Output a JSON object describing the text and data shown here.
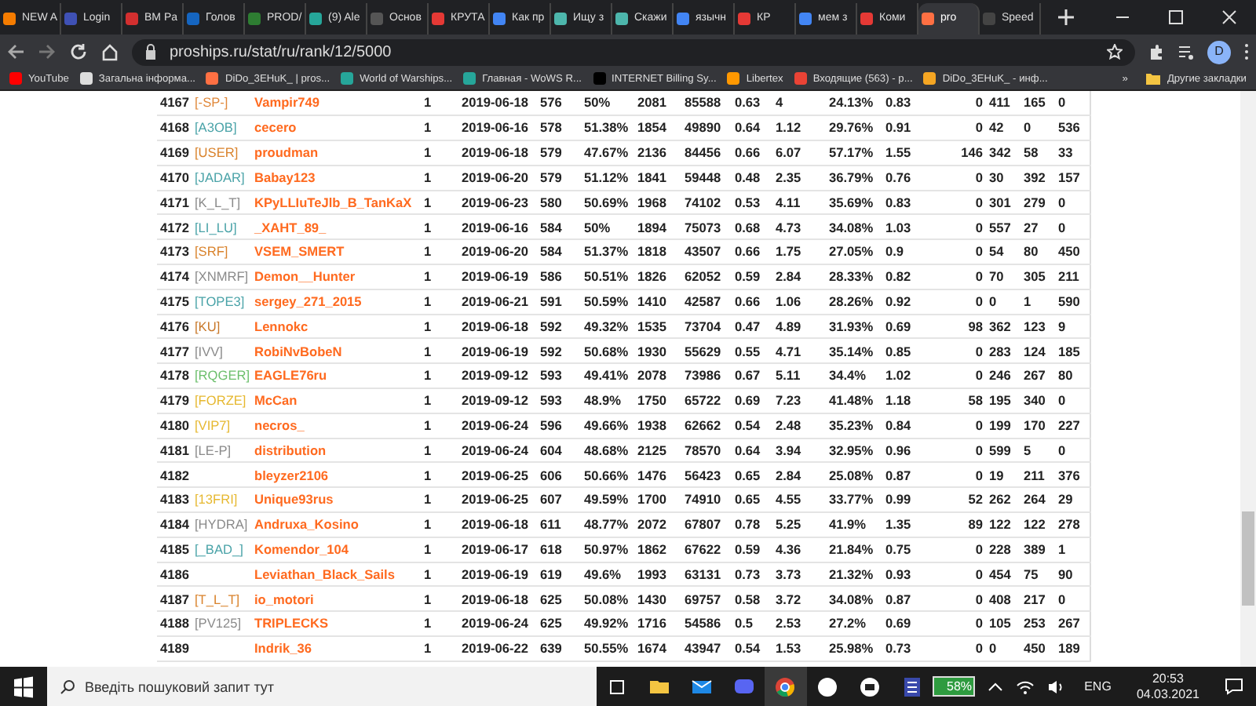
{
  "tabs": [
    {
      "label": "NEW A",
      "selected": false,
      "color": "#f57c00"
    },
    {
      "label": "Login",
      "selected": false,
      "color": "#3f51b5"
    },
    {
      "label": "BM Pa",
      "selected": false,
      "color": "#d32f2f"
    },
    {
      "label": "Голов",
      "selected": false,
      "color": "#1565c0"
    },
    {
      "label": "PROD/",
      "selected": false,
      "color": "#2e7d32"
    },
    {
      "label": "(9) Ale",
      "selected": false,
      "color": "#26a69a"
    },
    {
      "label": "Основ",
      "selected": false,
      "color": "#555555"
    },
    {
      "label": "КРУТА",
      "selected": false,
      "color": "#e53935"
    },
    {
      "label": "Как пр",
      "selected": false,
      "color": "#4285f4"
    },
    {
      "label": "Ищу з",
      "selected": false,
      "color": "#4db6ac"
    },
    {
      "label": "Скажи",
      "selected": false,
      "color": "#4db6ac"
    },
    {
      "label": "язычн",
      "selected": false,
      "color": "#4285f4"
    },
    {
      "label": "КР",
      "selected": false,
      "color": "#e53935"
    },
    {
      "label": "мем з",
      "selected": false,
      "color": "#4285f4"
    },
    {
      "label": "Коми",
      "selected": false,
      "color": "#e53935"
    },
    {
      "label": "pro",
      "selected": true,
      "color": "#ff7043"
    },
    {
      "label": "Speed",
      "selected": false,
      "color": "#444444"
    }
  ],
  "address": "proships.ru/stat/ru/rank/12/5000",
  "profile": "D",
  "bookmarks": [
    {
      "label": "YouTube",
      "color": "#ff0000"
    },
    {
      "label": "Загальна інформа...",
      "color": "#dddddd"
    },
    {
      "label": "DiDo_3EHuK_ | pros...",
      "color": "#ff7043"
    },
    {
      "label": "World of Warships...",
      "color": "#26a69a"
    },
    {
      "label": "Главная - WoWS R...",
      "color": "#26a69a"
    },
    {
      "label": "INTERNET Billing Sy...",
      "color": "#000000"
    },
    {
      "label": "Libertex",
      "color": "#ff9800"
    },
    {
      "label": "Входящие (563) - p...",
      "color": "#ea4335"
    },
    {
      "label": "DiDo_3EHuK_ - инф...",
      "color": "#f5a623"
    }
  ],
  "bookmarks_more": "»",
  "other_bookmarks": "Другие закладки",
  "table": {
    "rows": [
      {
        "number": "4167",
        "clan": {
          "text": "[-SP-]",
          "color": "#e0883a"
        },
        "player": "Vampir749",
        "values": [
          "1",
          "2019-06-18",
          "576",
          "50%",
          "2081",
          "85588",
          "0.63",
          "4",
          "24.13%",
          "0.83",
          "0",
          "411",
          "165",
          "0"
        ]
      },
      {
        "number": "4168",
        "clan": {
          "text": "[A3OB]",
          "color": "#4aa3a8"
        },
        "player": "cecero",
        "values": [
          "1",
          "2019-06-16",
          "578",
          "51.38%",
          "1854",
          "49890",
          "0.64",
          "1.12",
          "29.76%",
          "0.91",
          "0",
          "42",
          "0",
          "536"
        ]
      },
      {
        "number": "4169",
        "clan": {
          "text": "[USER]",
          "color": "#d9822b"
        },
        "player": "proudman",
        "values": [
          "1",
          "2019-06-18",
          "579",
          "47.67%",
          "2136",
          "84456",
          "0.66",
          "6.07",
          "57.17%",
          "1.55",
          "146",
          "342",
          "58",
          "33"
        ]
      },
      {
        "number": "4170",
        "clan": {
          "text": "[JADAR]",
          "color": "#4aa3a8"
        },
        "player": "Babay123",
        "values": [
          "1",
          "2019-06-20",
          "579",
          "51.12%",
          "1841",
          "59448",
          "0.48",
          "2.35",
          "36.79%",
          "0.76",
          "0",
          "30",
          "392",
          "157"
        ]
      },
      {
        "number": "4171",
        "clan": {
          "text": "[K_L_T]",
          "color": "#8a8a8a"
        },
        "player": "KPyLLIuTeJlb_B_TanKaX",
        "values": [
          "1",
          "2019-06-23",
          "580",
          "50.69%",
          "1968",
          "74102",
          "0.53",
          "4.11",
          "35.69%",
          "0.83",
          "0",
          "301",
          "279",
          "0"
        ]
      },
      {
        "number": "4172",
        "clan": {
          "text": "[LI_LU]",
          "color": "#4aa3a8"
        },
        "player": "_XAHT_89_",
        "values": [
          "1",
          "2019-06-16",
          "584",
          "50%",
          "1894",
          "75073",
          "0.68",
          "4.73",
          "34.08%",
          "1.03",
          "0",
          "557",
          "27",
          "0"
        ]
      },
      {
        "number": "4173",
        "clan": {
          "text": "[SRF]",
          "color": "#d9822b"
        },
        "player": "VSEM_SMERT",
        "values": [
          "1",
          "2019-06-20",
          "584",
          "51.37%",
          "1818",
          "43507",
          "0.66",
          "1.75",
          "27.05%",
          "0.9",
          "0",
          "54",
          "80",
          "450"
        ]
      },
      {
        "number": "4174",
        "clan": {
          "text": "[XNMRF]",
          "color": "#8a8a8a"
        },
        "player": "Demon__Hunter",
        "values": [
          "1",
          "2019-06-19",
          "586",
          "50.51%",
          "1826",
          "62052",
          "0.59",
          "2.84",
          "28.33%",
          "0.82",
          "0",
          "70",
          "305",
          "211"
        ]
      },
      {
        "number": "4175",
        "clan": {
          "text": "[TOPE3]",
          "color": "#4aa3a8"
        },
        "player": "sergey_271_2015",
        "values": [
          "1",
          "2019-06-21",
          "591",
          "50.59%",
          "1410",
          "42587",
          "0.66",
          "1.06",
          "28.26%",
          "0.92",
          "0",
          "0",
          "1",
          "590"
        ]
      },
      {
        "number": "4176",
        "clan": {
          "text": "[KU]",
          "color": "#c8782a"
        },
        "player": "Lennokc",
        "values": [
          "1",
          "2019-06-18",
          "592",
          "49.32%",
          "1535",
          "73704",
          "0.47",
          "4.89",
          "31.93%",
          "0.69",
          "98",
          "362",
          "123",
          "9"
        ]
      },
      {
        "number": "4177",
        "clan": {
          "text": "[IVV]",
          "color": "#8a8a8a"
        },
        "player": "RobiNvBobeN",
        "values": [
          "1",
          "2019-06-19",
          "592",
          "50.68%",
          "1930",
          "55629",
          "0.55",
          "4.71",
          "35.14%",
          "0.85",
          "0",
          "283",
          "124",
          "185"
        ]
      },
      {
        "number": "4178",
        "clan": {
          "text": "[RQGER]",
          "color": "#6cbf6c"
        },
        "player": "EAGLE76ru",
        "values": [
          "1",
          "2019-09-12",
          "593",
          "49.41%",
          "2078",
          "73986",
          "0.67",
          "5.11",
          "34.4%",
          "1.02",
          "0",
          "246",
          "267",
          "80"
        ]
      },
      {
        "number": "4179",
        "clan": {
          "text": "[FORZE]",
          "color": "#e6b830"
        },
        "player": "McCan",
        "values": [
          "1",
          "2019-09-12",
          "593",
          "48.9%",
          "1750",
          "65722",
          "0.69",
          "7.23",
          "41.48%",
          "1.18",
          "58",
          "195",
          "340",
          "0"
        ]
      },
      {
        "number": "4180",
        "clan": {
          "text": "[VIP7]",
          "color": "#e6b830"
        },
        "player": "necros_",
        "values": [
          "1",
          "2019-06-24",
          "596",
          "49.66%",
          "1938",
          "62662",
          "0.54",
          "2.48",
          "35.23%",
          "0.84",
          "0",
          "199",
          "170",
          "227"
        ]
      },
      {
        "number": "4181",
        "clan": {
          "text": "[LE-P]",
          "color": "#8a8a8a"
        },
        "player": "distribution",
        "values": [
          "1",
          "2019-06-24",
          "604",
          "48.68%",
          "2125",
          "78570",
          "0.64",
          "3.94",
          "32.95%",
          "0.96",
          "0",
          "599",
          "5",
          "0"
        ]
      },
      {
        "number": "4182",
        "player": "bleyzer2106",
        "values": [
          "1",
          "2019-06-25",
          "606",
          "50.66%",
          "1476",
          "56423",
          "0.65",
          "2.84",
          "25.08%",
          "0.87",
          "0",
          "19",
          "211",
          "376"
        ]
      },
      {
        "number": "4183",
        "clan": {
          "text": "[13FRI]",
          "color": "#e6b830"
        },
        "player": "Unique93rus",
        "values": [
          "1",
          "2019-06-25",
          "607",
          "49.59%",
          "1700",
          "74910",
          "0.65",
          "4.55",
          "33.77%",
          "0.99",
          "52",
          "262",
          "264",
          "29"
        ]
      },
      {
        "number": "4184",
        "clan": {
          "text": "[HYDRA]",
          "color": "#8a8a8a"
        },
        "player": "Andruxa_Kosino",
        "values": [
          "1",
          "2019-06-18",
          "611",
          "48.77%",
          "2072",
          "67807",
          "0.78",
          "5.25",
          "41.9%",
          "1.35",
          "89",
          "122",
          "122",
          "278"
        ]
      },
      {
        "number": "4185",
        "clan": {
          "text": "[_BAD_]",
          "color": "#4aa3a8"
        },
        "player": "Komendor_104",
        "values": [
          "1",
          "2019-06-17",
          "618",
          "50.97%",
          "1862",
          "67622",
          "0.59",
          "4.36",
          "21.84%",
          "0.75",
          "0",
          "228",
          "389",
          "1"
        ]
      },
      {
        "number": "4186",
        "player": "Leviathan_Black_Sails",
        "values": [
          "1",
          "2019-06-19",
          "619",
          "49.6%",
          "1993",
          "63131",
          "0.73",
          "3.73",
          "21.32%",
          "0.93",
          "0",
          "454",
          "75",
          "90"
        ]
      },
      {
        "number": "4187",
        "clan": {
          "text": "[T_L_T]",
          "color": "#d9822b"
        },
        "player": "io_motori",
        "values": [
          "1",
          "2019-06-18",
          "625",
          "50.08%",
          "1430",
          "69757",
          "0.58",
          "3.72",
          "34.08%",
          "0.87",
          "0",
          "408",
          "217",
          "0"
        ]
      },
      {
        "number": "4188",
        "clan": {
          "text": "[PV125]",
          "color": "#8a8a8a"
        },
        "player": "TRIPLECKS",
        "values": [
          "1",
          "2019-06-24",
          "625",
          "49.92%",
          "1716",
          "54586",
          "0.5",
          "2.53",
          "27.2%",
          "0.69",
          "0",
          "105",
          "253",
          "267"
        ]
      },
      {
        "number": "4189",
        "player": "Indrik_36",
        "values": [
          "1",
          "2019-06-22",
          "639",
          "50.55%",
          "1674",
          "43947",
          "0.54",
          "1.53",
          "25.98%",
          "0.73",
          "0",
          "0",
          "450",
          "189"
        ]
      }
    ]
  },
  "taskbar": {
    "search_placeholder": "Введіть пошуковий запит тут",
    "battery": {
      "text": "58%",
      "level": 0.58
    },
    "language": "ENG",
    "time": "20:53",
    "date": "04.03.2021"
  }
}
